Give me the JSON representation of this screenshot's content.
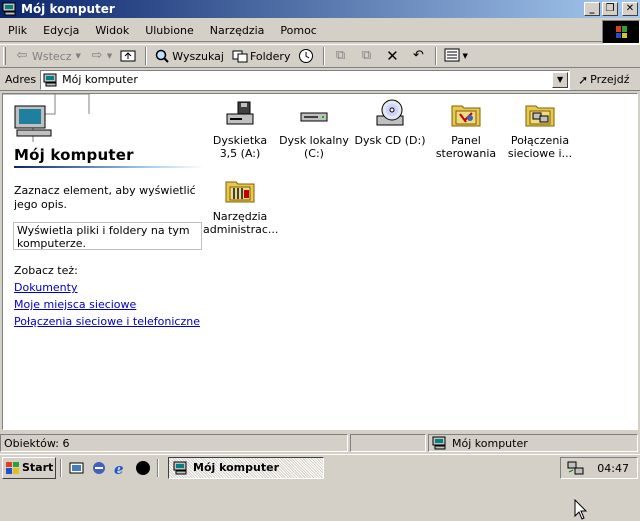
{
  "window": {
    "title": "Mój komputer",
    "controls": {
      "minimize": "_",
      "maximize": "❐",
      "close": "✕"
    }
  },
  "menubar": {
    "items": [
      "Plik",
      "Edycja",
      "Widok",
      "Ulubione",
      "Narzędzia",
      "Pomoc"
    ]
  },
  "toolbar": {
    "back_label": "Wstecz",
    "search_label": "Wyszukaj",
    "folders_label": "Foldery"
  },
  "address": {
    "label": "Adres",
    "value": "Mój komputer",
    "go_label": "Przejdź"
  },
  "left_pane": {
    "title": "Mój komputer",
    "hint": "Zaznacz element, aby wyświetlić jego opis.",
    "description": "Wyświetla pliki i foldery na tym komputerze.",
    "see_also": "Zobacz też:",
    "links": [
      "Dokumenty",
      "Moje miejsca sieciowe",
      "Połączenia sieciowe i telefoniczne"
    ]
  },
  "items": [
    {
      "label": "Dyskietka 3,5 (A:)",
      "icon": "floppy-drive-icon"
    },
    {
      "label": "Dysk lokalny (C:)",
      "icon": "hard-drive-icon"
    },
    {
      "label": "Dysk CD (D:)",
      "icon": "cd-drive-icon"
    },
    {
      "label": "Panel sterowania",
      "icon": "control-panel-icon"
    },
    {
      "label": "Połączenia sieciowe i...",
      "icon": "network-connections-icon"
    },
    {
      "label": "Narzędzia administrac...",
      "icon": "admin-tools-icon"
    }
  ],
  "statusbar": {
    "objects": "Obiektów: 6",
    "location": "Mój komputer"
  },
  "taskbar": {
    "start_label": "Start",
    "task_label": "Mój komputer",
    "clock": "04:47"
  }
}
